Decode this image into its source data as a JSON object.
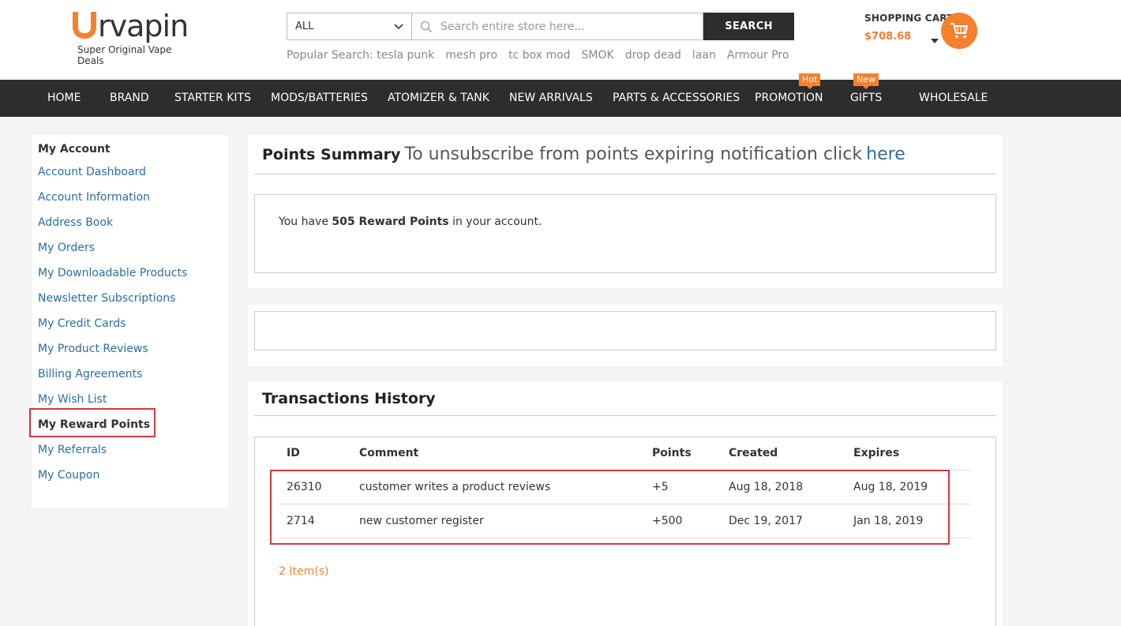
{
  "header": {
    "logo_text": "rvapin",
    "logo_tagline": "Super Original Vape Deals",
    "search": {
      "category": "ALL",
      "placeholder": "Search entire store here...",
      "button": "SEARCH"
    },
    "popular_label": "Popular Search:",
    "popular_terms": [
      "tesla punk",
      "mesh pro",
      "tc box mod",
      "SMOK",
      "drop dead",
      "laan",
      "Armour Pro"
    ],
    "cart": {
      "title": "SHOPPING CART",
      "amount": "$708.68"
    }
  },
  "nav": {
    "items": [
      {
        "label": "HOME"
      },
      {
        "label": "BRAND"
      },
      {
        "label": "STARTER KITS"
      },
      {
        "label": "MODS/BATTERIES"
      },
      {
        "label": "ATOMIZER & TANK"
      },
      {
        "label": "NEW ARRIVALS"
      },
      {
        "label": "PARTS & ACCESSORIES"
      },
      {
        "label": "PROMOTION",
        "badge": "Hot"
      },
      {
        "label": "GIFTS",
        "badge": "New"
      },
      {
        "label": "WHOLESALE"
      }
    ]
  },
  "sidebar": {
    "title": "My Account",
    "items": [
      {
        "label": "Account Dashboard"
      },
      {
        "label": "Account Information"
      },
      {
        "label": "Address Book"
      },
      {
        "label": "My Orders"
      },
      {
        "label": "My Downloadable Products"
      },
      {
        "label": "Newsletter Subscriptions"
      },
      {
        "label": "My Credit Cards"
      },
      {
        "label": "My Product Reviews"
      },
      {
        "label": "Billing Agreements"
      },
      {
        "label": "My Wish List"
      },
      {
        "label": "My Reward Points"
      },
      {
        "label": "My Referrals"
      },
      {
        "label": "My Coupon"
      }
    ]
  },
  "summary": {
    "title": "Points Summary",
    "unsubscribe_text": "To unsubscribe from points expiring notification click",
    "unsubscribe_link": "here",
    "balance_prefix": "You have",
    "balance_value": "505 Reward Points",
    "balance_suffix": "in your account."
  },
  "transactions": {
    "title": "Transactions History",
    "columns": [
      "ID",
      "Comment",
      "Points",
      "Created",
      "Expires"
    ],
    "rows": [
      [
        "26310",
        "customer writes a product reviews",
        "+5",
        "Aug 18, 2018",
        "Aug 18, 2019"
      ],
      [
        "2714",
        "new customer register",
        "+500",
        "Dec 19, 2017",
        "Jan 18, 2019"
      ]
    ],
    "item_count": "2 Item(s)"
  },
  "colors": {
    "accent": "#f5802e",
    "link": "#2b6ea1",
    "nav_bg": "#2d2d2d",
    "highlight": "#d9363e"
  }
}
